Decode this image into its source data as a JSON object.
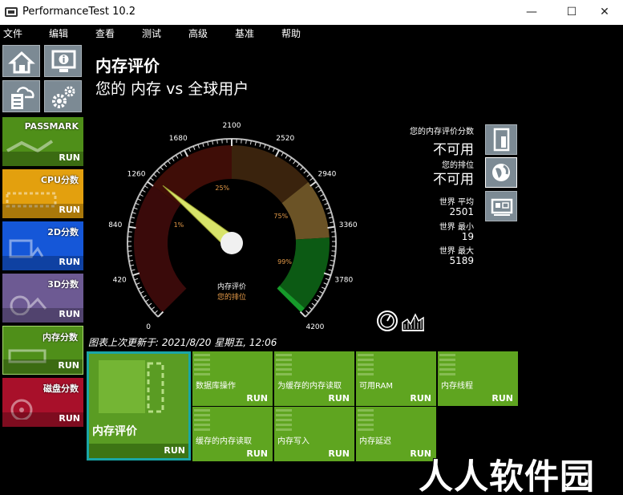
{
  "window": {
    "title": "PerformanceTest 10.2",
    "minimize": "—",
    "maximize": "☐",
    "close": "✕"
  },
  "menu": [
    "文件",
    "编辑",
    "查看",
    "测试",
    "高级",
    "基准",
    "帮助"
  ],
  "sidebar": {
    "tiles": [
      {
        "label": "PASSMARK",
        "run": "RUN",
        "color": "#4f8f19"
      },
      {
        "label": "CPU分数",
        "run": "RUN",
        "color": "#e3a00e"
      },
      {
        "label": "2D分数",
        "run": "RUN",
        "color": "#1557d8"
      },
      {
        "label": "3D分数",
        "run": "RUN",
        "color": "#6d5a93"
      },
      {
        "label": "内存分数",
        "run": "RUN",
        "color": "#4f8f19"
      },
      {
        "label": "磁盘分数",
        "run": "RUN",
        "color": "#a8102a"
      }
    ]
  },
  "header": {
    "title": "内存评价",
    "subtitle": "您的 内存 vs 全球用户"
  },
  "gauge": {
    "ticks": [
      "0",
      "420",
      "840",
      "1260",
      "1680",
      "2100",
      "2520",
      "2940",
      "3360",
      "3780",
      "4200"
    ],
    "percent_labels": [
      "1%",
      "25%",
      "75%",
      "99%"
    ],
    "center_label": "内存评价",
    "center_sub": "您的排位",
    "min": 0,
    "max": 4200,
    "needle_value": 1320
  },
  "info": {
    "score_label": "您的内存评价分数",
    "score_value": "不可用",
    "rank_label": "您的排位",
    "rank_value": "不可用",
    "avg_label": "世界 平均",
    "avg_value": "2501",
    "min_label": "世界 最小",
    "min_value": "19",
    "max_label": "世界 最大",
    "max_value": "5189"
  },
  "updated": "图表上次更新于: 2021/8/20 星期五, 12:06",
  "tests": {
    "main": {
      "label": "内存评价",
      "run": "RUN"
    },
    "items": [
      {
        "label": "数据库操作",
        "run": "RUN"
      },
      {
        "label": "为缓存的内存读取",
        "run": "RUN"
      },
      {
        "label": "可用RAM",
        "run": "RUN"
      },
      {
        "label": "内存线程",
        "run": "RUN"
      },
      {
        "label": "缓存的内存读取",
        "run": "RUN"
      },
      {
        "label": "内存写入",
        "run": "RUN"
      },
      {
        "label": "内存延迟",
        "run": "RUN"
      }
    ]
  },
  "watermark": "人人软件园"
}
